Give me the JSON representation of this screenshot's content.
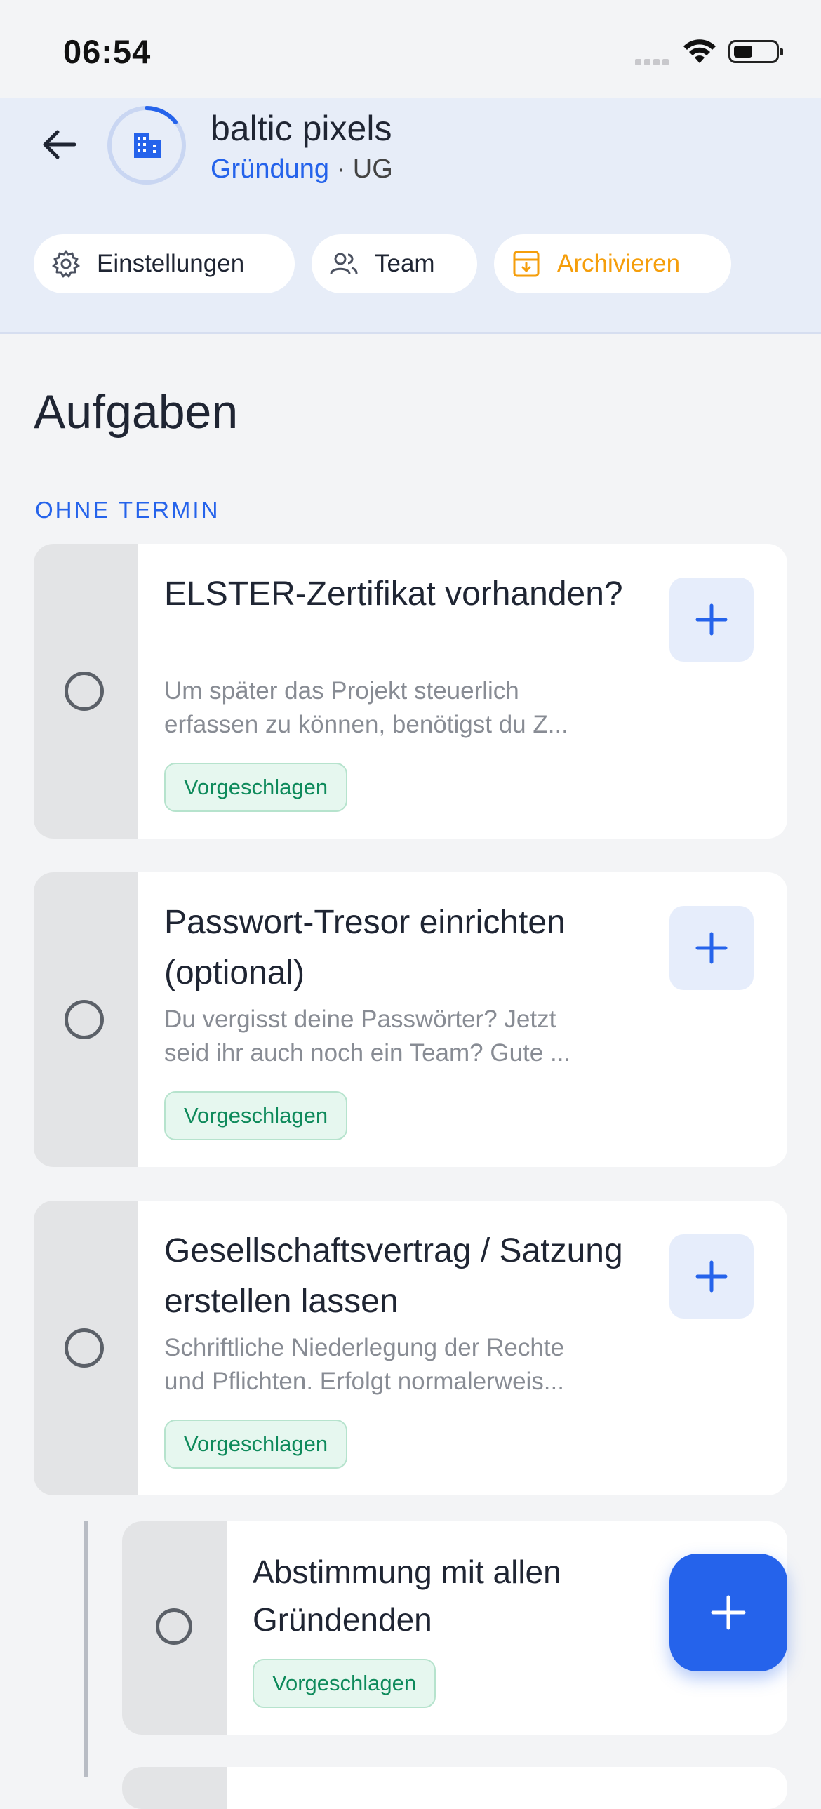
{
  "status_bar": {
    "time": "06:54"
  },
  "project": {
    "name": "baltic pixels",
    "stage": "Gründung",
    "separator": " · ",
    "legal_form": "UG"
  },
  "actions": {
    "settings_label": "Einstellungen",
    "team_label": "Team",
    "archive_label": "Archivieren"
  },
  "colors": {
    "accent": "#2563eb",
    "archive": "#f59e0b",
    "badge_text": "#0e8a5b",
    "badge_bg": "#e6f7ef"
  },
  "page": {
    "title": "Aufgaben",
    "group_label": "OHNE TERMIN"
  },
  "tasks": [
    {
      "title": "ELSTER-Zertifikat vorhanden?",
      "description": "Um später das Projekt steuerlich\nerfassen zu können, benötigst du Z...",
      "badge": "Vorgeschlagen"
    },
    {
      "title": "Passwort-Tresor einrichten (optional)",
      "description": "Du vergisst deine Passwörter? Jetzt\nseid ihr auch noch ein Team? Gute ...",
      "badge": "Vorgeschlagen"
    },
    {
      "title": "Gesellschaftsvertrag / Satzung erstellen lassen",
      "description": "Schriftliche Niederlegung der Rechte\nund Pflichten. Erfolgt normalerweis...",
      "badge": "Vorgeschlagen"
    },
    {
      "title": "Abstimmung mit allen Gründenden",
      "badge": "Vorgeschlagen"
    }
  ],
  "icons": {
    "back": "arrow-left-icon",
    "avatar": "building-icon",
    "settings": "gear-icon",
    "team": "people-icon",
    "archive": "archive-box-icon",
    "add": "plus-icon"
  }
}
